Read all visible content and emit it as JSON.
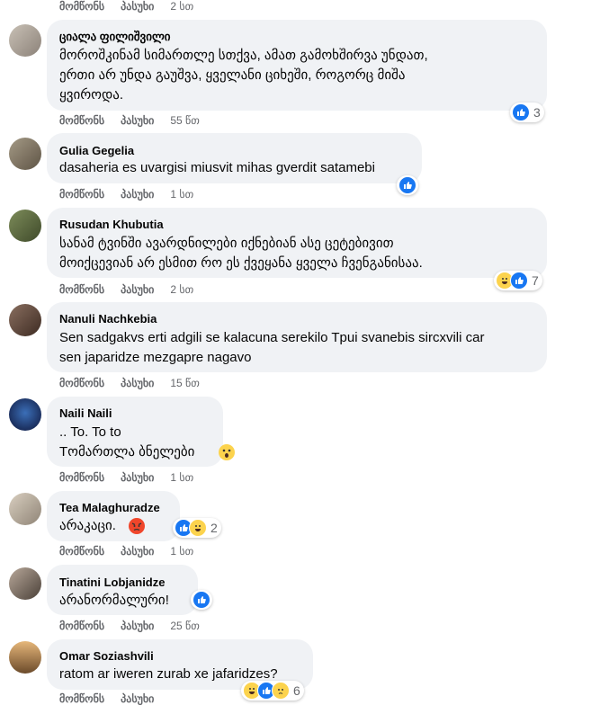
{
  "labels": {
    "like": "მომწონს",
    "reply": "პასუხი"
  },
  "top_time": "2 სთ",
  "comments": [
    {
      "name": "ციალა ფილიშვილი",
      "lines": [
        "მოროშკინამ სიმართლე სთქვა, ამათ გამოხშირვა უნდათ,",
        "ერთი არ უნდა გაუშვა, ყველანი ციხეში, როგორც მიშა",
        "ყვიროდა."
      ],
      "time": "55 წთ",
      "reactions": [
        "like"
      ],
      "reaction_count": "3"
    },
    {
      "name": "Gulia Gegelia",
      "lines": [
        "dasaheria es uvargisi miusvit mihas gverdit satamebi"
      ],
      "time": "1 სთ",
      "reactions": [
        "like"
      ],
      "reaction_count": ""
    },
    {
      "name": "Rusudan Khubutia",
      "lines": [
        "სანამ ტვინში ავარდნილები იქნებიან ასე ცეტებივით",
        "მოიქცევიან არ ესმით რო ეს ქვეყანა ყველა ჩვენგანისაა."
      ],
      "time": "2 სთ",
      "reactions": [
        "haha",
        "like"
      ],
      "reaction_count": "7"
    },
    {
      "name": "Nanuli Nachkebia",
      "lines": [
        "Sen sadgakvs erti adgili se kalacuna serekilo Tpui svanebis sircxvili car",
        "sen japaridze mezgapre nagavo"
      ],
      "time": "15 წთ",
      "reactions": [],
      "reaction_count": ""
    },
    {
      "name": "Naili Naili",
      "lines": [
        ".. To. To to",
        "Tომართლა ბნელები"
      ],
      "time": "1 სთ",
      "reactions": [],
      "reaction_count": ""
    },
    {
      "name": "Tea Malaghuradze",
      "lines": [
        "არაკაცი."
      ],
      "time": "1 სთ",
      "reactions": [
        "like",
        "haha"
      ],
      "reaction_count": "2"
    },
    {
      "name": "Tinatini Lobjanidze",
      "lines": [
        "არანორმალური!"
      ],
      "time": "25 წთ",
      "reactions": [
        "like"
      ],
      "reaction_count": ""
    },
    {
      "name": "Omar Soziashvili",
      "lines": [
        "ratom ar iweren zurab xe jafaridzes?"
      ],
      "time": "",
      "reactions": [
        "haha",
        "like",
        "sad"
      ],
      "reaction_count": "6"
    }
  ]
}
